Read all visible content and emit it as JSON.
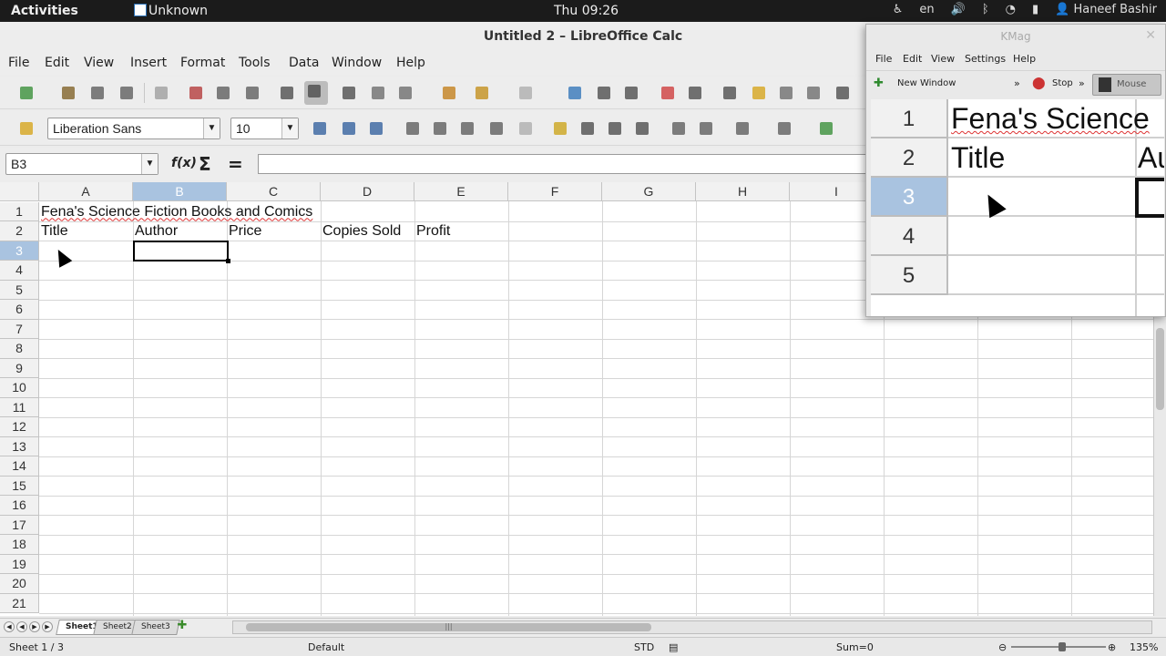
{
  "topbar": {
    "activities": "Activities",
    "app_name": "Unknown",
    "clock": "Thu 09:26",
    "language": "en",
    "user": "Haneef Bashir"
  },
  "window": {
    "title": "Untitled 2 – LibreOffice Calc"
  },
  "menu": [
    "File",
    "Edit",
    "View",
    "Insert",
    "Format",
    "Tools",
    "Data",
    "Window",
    "Help"
  ],
  "formatting": {
    "font_name": "Liberation Sans",
    "font_size": "10"
  },
  "formula_bar": {
    "cell_ref": "B3",
    "formula": ""
  },
  "sheet": {
    "columns": [
      "A",
      "B",
      "C",
      "D",
      "E",
      "F",
      "G",
      "H",
      "I"
    ],
    "rows": [
      "1",
      "2",
      "3",
      "4",
      "5",
      "6",
      "7",
      "8",
      "9",
      "10",
      "11",
      "12",
      "13",
      "14",
      "15",
      "16",
      "17",
      "18",
      "19",
      "20",
      "21"
    ],
    "selected_cell": "B3",
    "cells": {
      "A1": "Fena's Science Fiction Books and Comics",
      "A2": "Title",
      "B2": "Author",
      "C2": "Price",
      "D2": "Copies Sold",
      "E2": "Profit"
    }
  },
  "tabs": [
    "Sheet1",
    "Sheet2",
    "Sheet3"
  ],
  "active_tab": "Sheet1",
  "status": {
    "sheet": "Sheet 1 / 3",
    "page_style": "Default",
    "selection_mode": "STD",
    "sum": "Sum=0",
    "zoom": "135%"
  },
  "kmag": {
    "title": "KMag",
    "menu": [
      "File",
      "Edit",
      "View",
      "Settings",
      "Help"
    ],
    "new_window": "New Window",
    "stop": "Stop",
    "mouse": "Mouse",
    "rows": [
      "1",
      "2",
      "3",
      "4",
      "5"
    ],
    "cell_a1": "Fena's Science",
    "cell_a2": "Title",
    "cell_b2": "Au"
  },
  "colors": {
    "selection_header": "#a9c3e0",
    "top_bar": "#1b1b1b"
  }
}
